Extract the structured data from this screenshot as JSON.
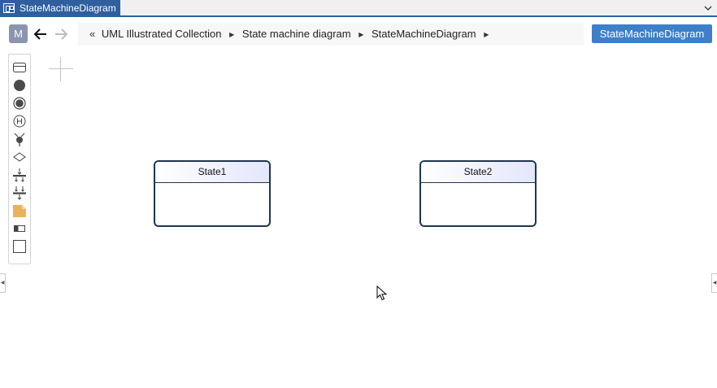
{
  "window": {
    "tab_title": "StateMachineDiagram",
    "tab_icon": "diagram-icon",
    "tab_menu_icon": "chevron-down-icon"
  },
  "nav": {
    "avatar_letter": "M",
    "back_icon": "arrow-left-icon",
    "forward_icon": "arrow-right-icon",
    "breadcrumb": {
      "prev_marker": "«",
      "items": [
        "UML Illustrated Collection",
        "State machine diagram",
        "StateMachineDiagram"
      ],
      "separator_icon": "caret-right-icon"
    },
    "diagram_button_label": "StateMachineDiagram"
  },
  "palette": {
    "tools": [
      {
        "name": "state-tool",
        "icon": "state-box-icon"
      },
      {
        "name": "initial-state-tool",
        "icon": "filled-circle-icon"
      },
      {
        "name": "final-state-tool",
        "icon": "bullseye-icon"
      },
      {
        "name": "history-state-tool",
        "icon": "history-h-icon"
      },
      {
        "name": "transition-tool",
        "icon": "transition-icon"
      },
      {
        "name": "choice-tool",
        "icon": "diamond-icon"
      },
      {
        "name": "fork-tool",
        "icon": "fork-icon"
      },
      {
        "name": "join-tool",
        "icon": "join-icon"
      },
      {
        "name": "note-tool",
        "icon": "note-icon"
      },
      {
        "name": "frame-tool",
        "icon": "frame-icon"
      },
      {
        "name": "rectangle-tool",
        "icon": "rectangle-icon"
      }
    ]
  },
  "diagram": {
    "states": [
      {
        "name": "State1"
      },
      {
        "name": "State2"
      }
    ]
  },
  "colors": {
    "accent": "#2f5f9e",
    "button": "#3d7fc9",
    "state_border": "#1f3550",
    "state_header_gradient_end": "#e4e6fb",
    "note": "#e8b35c"
  }
}
